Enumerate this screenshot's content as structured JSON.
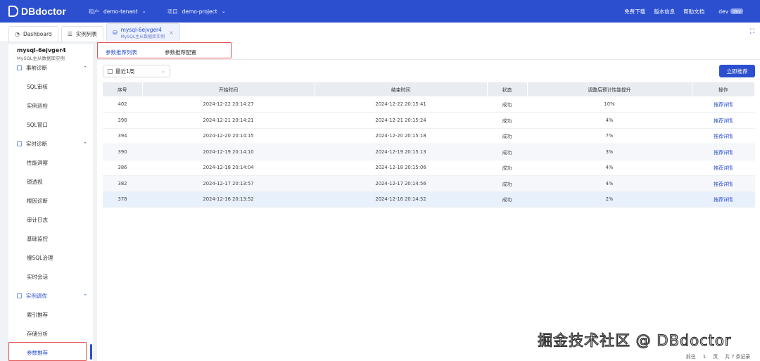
{
  "header": {
    "brand": "DBdoctor",
    "tenant_key": "租户",
    "tenant_value": "demo-tenant",
    "project_key": "项目",
    "project_value": "demo-project",
    "links": [
      "免费下载",
      "版本信息",
      "帮助文档"
    ],
    "user": "dev",
    "user_badge": "dev"
  },
  "tabs": {
    "dashboard": "Dashboard",
    "instances": "实例列表",
    "active_title": "mysql-6ejvger4",
    "active_subtitle": "MySQL主从数据库实例"
  },
  "sidebar": {
    "instance_name": "mysql-6ejvger4",
    "instance_desc": "MySQL主从数据库实例",
    "groups": [
      {
        "label": "事前诊断",
        "items": [
          "SQL审核",
          "实例巡检",
          "SQL窗口"
        ]
      },
      {
        "label": "实时诊断",
        "items": [
          "性能洞察",
          "锁透视",
          "根因诊断",
          "审计日志",
          "基础监控",
          "慢SQL治理",
          "实时会话"
        ]
      },
      {
        "label": "实例调优",
        "items": [
          "索引推荐",
          "存储分析",
          "参数推荐"
        ]
      }
    ],
    "active_item": "参数推荐"
  },
  "main": {
    "subtabs": [
      "参数推荐列表",
      "参数推荐配置"
    ],
    "date_range": "最近1周",
    "recommend_button": "立即推荐",
    "columns": [
      "序号",
      "开始时间",
      "结束时间",
      "状态",
      "调整后预计性能提升",
      "操作"
    ],
    "rows": [
      [
        "402",
        "2024-12-22 20:14:27",
        "2024-12-22 20:15:41",
        "成功",
        "10%",
        "推荐详情"
      ],
      [
        "398",
        "2024-12-21 20:14:21",
        "2024-12-21 20:15:24",
        "成功",
        "4%",
        "推荐详情"
      ],
      [
        "394",
        "2024-12-20 20:14:15",
        "2024-12-20 20:15:18",
        "成功",
        "7%",
        "推荐详情"
      ],
      [
        "390",
        "2024-12-19 20:14:10",
        "2024-12-19 20:15:13",
        "成功",
        "3%",
        "推荐详情"
      ],
      [
        "386",
        "2024-12-18 20:14:04",
        "2024-12-18 20:15:06",
        "成功",
        "4%",
        "推荐详情"
      ],
      [
        "382",
        "2024-12-17 20:13:57",
        "2024-12-17 20:14:56",
        "成功",
        "4%",
        "推荐详情"
      ],
      [
        "378",
        "2024-12-16 20:13:52",
        "2024-12-16 20:14:52",
        "成功",
        "2%",
        "推荐详情"
      ]
    ],
    "pager": {
      "goto": "前往",
      "page": "1",
      "page_unit": "页",
      "total": "共 7 条记录"
    }
  },
  "watermark": "掘金技术社区 @ DBdoctor",
  "colors": {
    "brand_blue": "#2b4fcf",
    "highlight_red": "#e05555"
  }
}
